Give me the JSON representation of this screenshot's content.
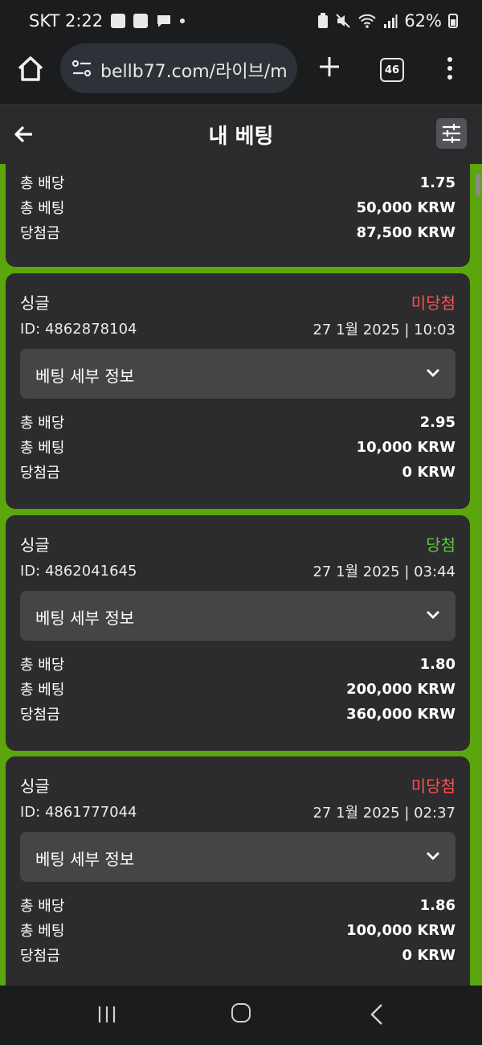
{
  "status_bar": {
    "carrier_time": "SKT 2:22",
    "battery": "62%"
  },
  "browser": {
    "url": "bellb77.com/라이브/m",
    "tab_count": "46"
  },
  "app": {
    "title": "내 베팅"
  },
  "labels": {
    "total_odds": "총 배당",
    "total_bet": "총 베팅",
    "winnings": "당첨금",
    "bet_details": "베팅 세부 정보"
  },
  "bets": [
    {
      "total_odds": "1.75",
      "total_bet": "50,000 KRW",
      "winnings": "87,500 KRW"
    },
    {
      "type": "싱글",
      "status": "미당첨",
      "id": "ID: 4862878104",
      "datetime": "27 1월 2025 | 10:03",
      "total_odds": "2.95",
      "total_bet": "10,000 KRW",
      "winnings": "0 KRW"
    },
    {
      "type": "싱글",
      "status": "당첨",
      "id": "ID: 4862041645",
      "datetime": "27 1월 2025 | 03:44",
      "total_odds": "1.80",
      "total_bet": "200,000 KRW",
      "winnings": "360,000 KRW"
    },
    {
      "type": "싱글",
      "status": "미당첨",
      "id": "ID: 4861777044",
      "datetime": "27 1월 2025 | 02:37",
      "total_odds": "1.86",
      "total_bet": "100,000 KRW",
      "winnings": "0 KRW"
    }
  ],
  "colors": {
    "background_green": "#5aa60c",
    "card": "#2c2c2e",
    "lose": "#ff4f4f",
    "win": "#57c93a"
  }
}
